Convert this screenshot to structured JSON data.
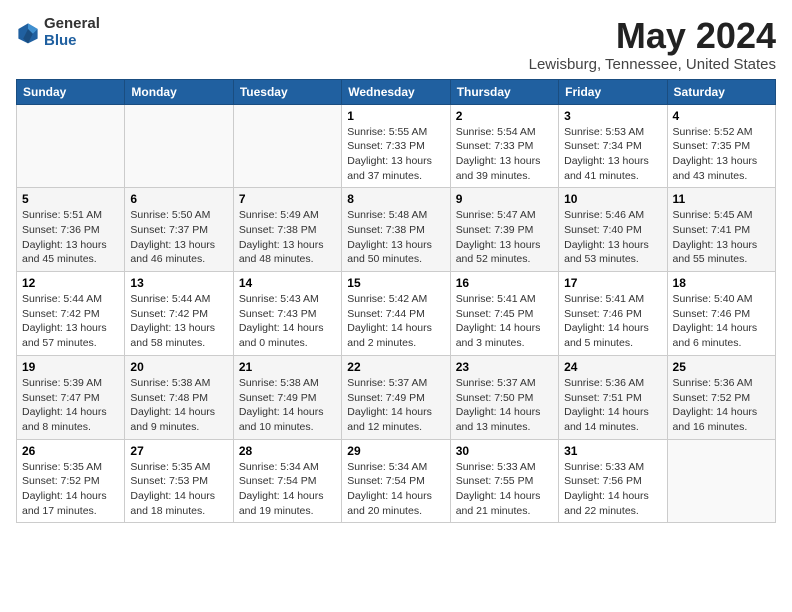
{
  "logo": {
    "general": "General",
    "blue": "Blue"
  },
  "title": "May 2024",
  "subtitle": "Lewisburg, Tennessee, United States",
  "days_of_week": [
    "Sunday",
    "Monday",
    "Tuesday",
    "Wednesday",
    "Thursday",
    "Friday",
    "Saturday"
  ],
  "weeks": [
    [
      {
        "day": "",
        "info": ""
      },
      {
        "day": "",
        "info": ""
      },
      {
        "day": "",
        "info": ""
      },
      {
        "day": "1",
        "info": "Sunrise: 5:55 AM\nSunset: 7:33 PM\nDaylight: 13 hours and 37 minutes."
      },
      {
        "day": "2",
        "info": "Sunrise: 5:54 AM\nSunset: 7:33 PM\nDaylight: 13 hours and 39 minutes."
      },
      {
        "day": "3",
        "info": "Sunrise: 5:53 AM\nSunset: 7:34 PM\nDaylight: 13 hours and 41 minutes."
      },
      {
        "day": "4",
        "info": "Sunrise: 5:52 AM\nSunset: 7:35 PM\nDaylight: 13 hours and 43 minutes."
      }
    ],
    [
      {
        "day": "5",
        "info": "Sunrise: 5:51 AM\nSunset: 7:36 PM\nDaylight: 13 hours and 45 minutes."
      },
      {
        "day": "6",
        "info": "Sunrise: 5:50 AM\nSunset: 7:37 PM\nDaylight: 13 hours and 46 minutes."
      },
      {
        "day": "7",
        "info": "Sunrise: 5:49 AM\nSunset: 7:38 PM\nDaylight: 13 hours and 48 minutes."
      },
      {
        "day": "8",
        "info": "Sunrise: 5:48 AM\nSunset: 7:38 PM\nDaylight: 13 hours and 50 minutes."
      },
      {
        "day": "9",
        "info": "Sunrise: 5:47 AM\nSunset: 7:39 PM\nDaylight: 13 hours and 52 minutes."
      },
      {
        "day": "10",
        "info": "Sunrise: 5:46 AM\nSunset: 7:40 PM\nDaylight: 13 hours and 53 minutes."
      },
      {
        "day": "11",
        "info": "Sunrise: 5:45 AM\nSunset: 7:41 PM\nDaylight: 13 hours and 55 minutes."
      }
    ],
    [
      {
        "day": "12",
        "info": "Sunrise: 5:44 AM\nSunset: 7:42 PM\nDaylight: 13 hours and 57 minutes."
      },
      {
        "day": "13",
        "info": "Sunrise: 5:44 AM\nSunset: 7:42 PM\nDaylight: 13 hours and 58 minutes."
      },
      {
        "day": "14",
        "info": "Sunrise: 5:43 AM\nSunset: 7:43 PM\nDaylight: 14 hours and 0 minutes."
      },
      {
        "day": "15",
        "info": "Sunrise: 5:42 AM\nSunset: 7:44 PM\nDaylight: 14 hours and 2 minutes."
      },
      {
        "day": "16",
        "info": "Sunrise: 5:41 AM\nSunset: 7:45 PM\nDaylight: 14 hours and 3 minutes."
      },
      {
        "day": "17",
        "info": "Sunrise: 5:41 AM\nSunset: 7:46 PM\nDaylight: 14 hours and 5 minutes."
      },
      {
        "day": "18",
        "info": "Sunrise: 5:40 AM\nSunset: 7:46 PM\nDaylight: 14 hours and 6 minutes."
      }
    ],
    [
      {
        "day": "19",
        "info": "Sunrise: 5:39 AM\nSunset: 7:47 PM\nDaylight: 14 hours and 8 minutes."
      },
      {
        "day": "20",
        "info": "Sunrise: 5:38 AM\nSunset: 7:48 PM\nDaylight: 14 hours and 9 minutes."
      },
      {
        "day": "21",
        "info": "Sunrise: 5:38 AM\nSunset: 7:49 PM\nDaylight: 14 hours and 10 minutes."
      },
      {
        "day": "22",
        "info": "Sunrise: 5:37 AM\nSunset: 7:49 PM\nDaylight: 14 hours and 12 minutes."
      },
      {
        "day": "23",
        "info": "Sunrise: 5:37 AM\nSunset: 7:50 PM\nDaylight: 14 hours and 13 minutes."
      },
      {
        "day": "24",
        "info": "Sunrise: 5:36 AM\nSunset: 7:51 PM\nDaylight: 14 hours and 14 minutes."
      },
      {
        "day": "25",
        "info": "Sunrise: 5:36 AM\nSunset: 7:52 PM\nDaylight: 14 hours and 16 minutes."
      }
    ],
    [
      {
        "day": "26",
        "info": "Sunrise: 5:35 AM\nSunset: 7:52 PM\nDaylight: 14 hours and 17 minutes."
      },
      {
        "day": "27",
        "info": "Sunrise: 5:35 AM\nSunset: 7:53 PM\nDaylight: 14 hours and 18 minutes."
      },
      {
        "day": "28",
        "info": "Sunrise: 5:34 AM\nSunset: 7:54 PM\nDaylight: 14 hours and 19 minutes."
      },
      {
        "day": "29",
        "info": "Sunrise: 5:34 AM\nSunset: 7:54 PM\nDaylight: 14 hours and 20 minutes."
      },
      {
        "day": "30",
        "info": "Sunrise: 5:33 AM\nSunset: 7:55 PM\nDaylight: 14 hours and 21 minutes."
      },
      {
        "day": "31",
        "info": "Sunrise: 5:33 AM\nSunset: 7:56 PM\nDaylight: 14 hours and 22 minutes."
      },
      {
        "day": "",
        "info": ""
      }
    ]
  ]
}
